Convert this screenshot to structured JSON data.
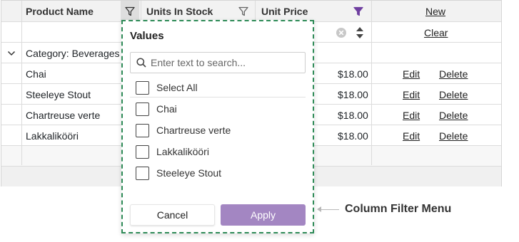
{
  "grid": {
    "columns": [
      {
        "label": "Product Name",
        "filter_icon": "funnel-outline-icon"
      },
      {
        "label": "Units In Stock",
        "filter_icon": "funnel-outline-icon"
      },
      {
        "label": "Unit Price",
        "filter_icon": "funnel-filled-icon",
        "filter_color": "#6f3fa0"
      }
    ],
    "new_label": "New",
    "clear_label": "Clear",
    "group_label": "Category: Beverages",
    "rows": [
      {
        "name": "Chai",
        "price": "$18.00"
      },
      {
        "name": "Steeleye Stout",
        "price": "$18.00"
      },
      {
        "name": "Chartreuse verte",
        "price": "$18.00"
      },
      {
        "name": "Lakkalikööri",
        "price": "$18.00"
      }
    ],
    "edit_label": "Edit",
    "delete_label": "Delete"
  },
  "filter_menu": {
    "title": "Values",
    "search_placeholder": "Enter text to search...",
    "options": [
      "Select All",
      "Chai",
      "Chartreuse verte",
      "Lakkalikööri",
      "Steeleye Stout"
    ],
    "cancel_label": "Cancel",
    "apply_label": "Apply",
    "apply_color": "#a386c2",
    "border_color": "#2e8b57"
  },
  "callout": {
    "text": "Column Filter Menu"
  }
}
